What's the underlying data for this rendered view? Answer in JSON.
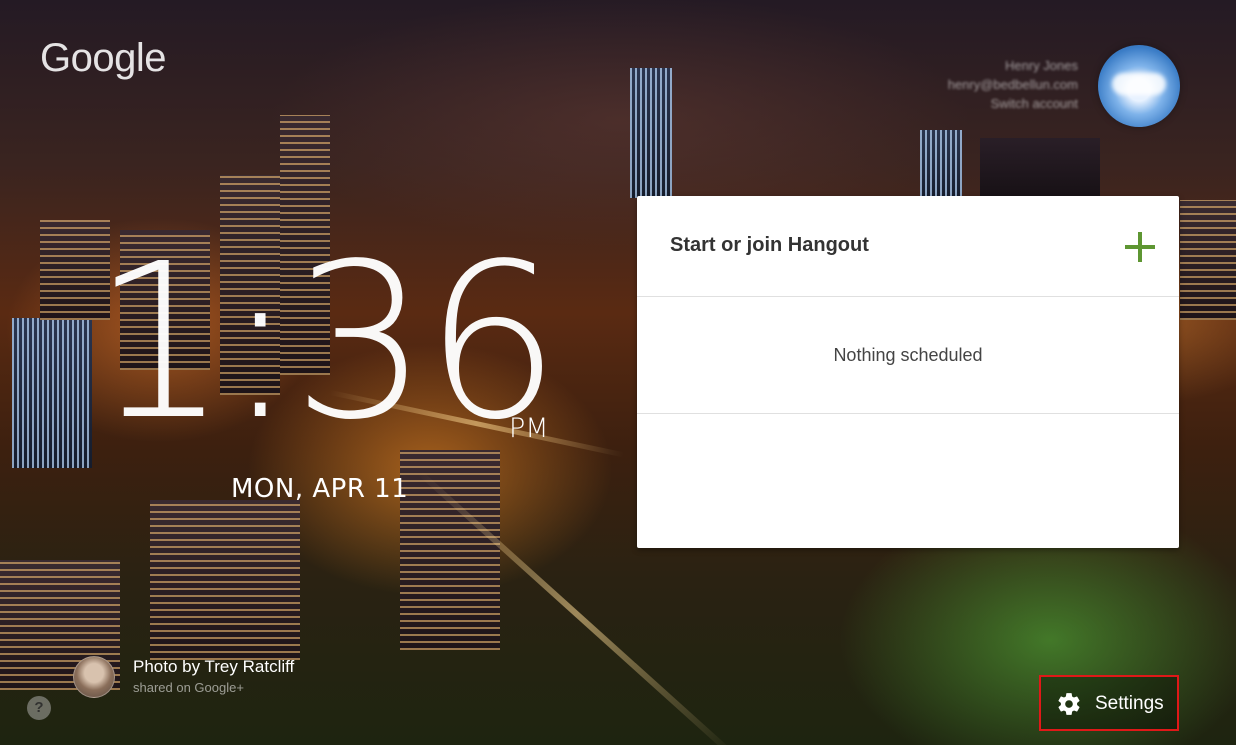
{
  "brand": {
    "logo_text": "Google"
  },
  "account": {
    "name": "Henry Jones",
    "email": "henry@bedbellun.com",
    "switch_label": "Switch account"
  },
  "clock": {
    "time": "1:36",
    "ampm": "PM",
    "date": "MON, APR 11"
  },
  "hangout_card": {
    "title": "Start or join Hangout",
    "add_icon": "plus-icon",
    "empty_message": "Nothing scheduled",
    "accent_color": "#5e9632"
  },
  "photo_credit": {
    "title": "Photo by Trey Ratcliff",
    "subtitle": "shared on Google+"
  },
  "help": {
    "label": "?"
  },
  "settings": {
    "label": "Settings",
    "icon": "gear-icon",
    "highlight_color": "#e01818"
  }
}
